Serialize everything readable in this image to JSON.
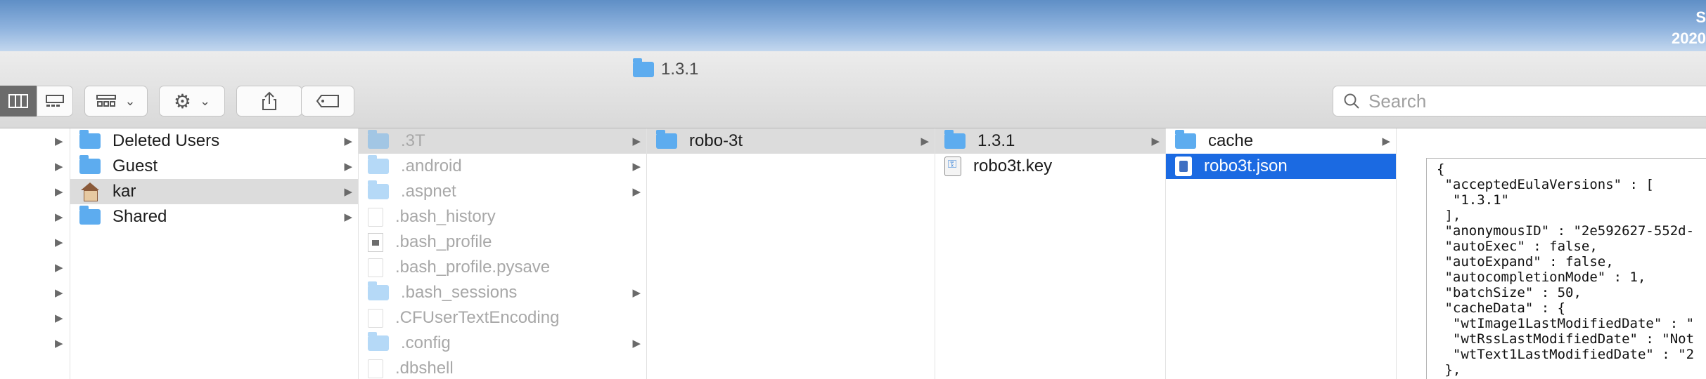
{
  "desktop": {
    "clock_line1": "S",
    "clock_line2": "2020"
  },
  "window": {
    "title": "1.3.1"
  },
  "toolbar": {
    "view_columns": "columns-view-icon",
    "view_gallery": "gallery-view-icon",
    "group": "grid-group-icon",
    "action": "gear-icon",
    "share": "share-icon",
    "tags": "tag-icon"
  },
  "search": {
    "placeholder": "Search"
  },
  "column1": {
    "items": [
      {
        "label": "Deleted Users"
      },
      {
        "label": "Guest"
      },
      {
        "label": "kar"
      },
      {
        "label": "Shared"
      }
    ]
  },
  "column2": {
    "items": [
      {
        "label": ".3T"
      },
      {
        "label": ".android"
      },
      {
        "label": ".aspnet"
      },
      {
        "label": ".bash_history"
      },
      {
        "label": ".bash_profile"
      },
      {
        "label": ".bash_profile.pysave"
      },
      {
        "label": ".bash_sessions"
      },
      {
        "label": ".CFUserTextEncoding"
      },
      {
        "label": ".config"
      },
      {
        "label": ".dbshell"
      }
    ]
  },
  "column3": {
    "items": [
      {
        "label": "robo-3t"
      }
    ]
  },
  "column4": {
    "items": [
      {
        "label": "1.3.1"
      },
      {
        "label": "robo3t.key"
      }
    ]
  },
  "column5": {
    "items": [
      {
        "label": "cache"
      },
      {
        "label": "robo3t.json"
      }
    ]
  },
  "preview": {
    "text": "{\n \"acceptedEulaVersions\" : [\n  \"1.3.1\"\n ],\n \"anonymousID\" : \"2e592627-552d-\n \"autoExec\" : false,\n \"autoExpand\" : false,\n \"autocompletionMode\" : 1,\n \"batchSize\" : 50,\n \"cacheData\" : {\n  \"wtImage1LastModifiedDate\" : \"\n  \"wtRssLastModifiedDate\" : \"Not\n  \"wtText1LastModifiedDate\" : \"2\n },\n \"checkForUpdates\" : true,"
  },
  "colors": {
    "selection_blue": "#1b6ae2",
    "folder_blue": "#5dacef",
    "selection_gray": "#dcdcdc"
  }
}
